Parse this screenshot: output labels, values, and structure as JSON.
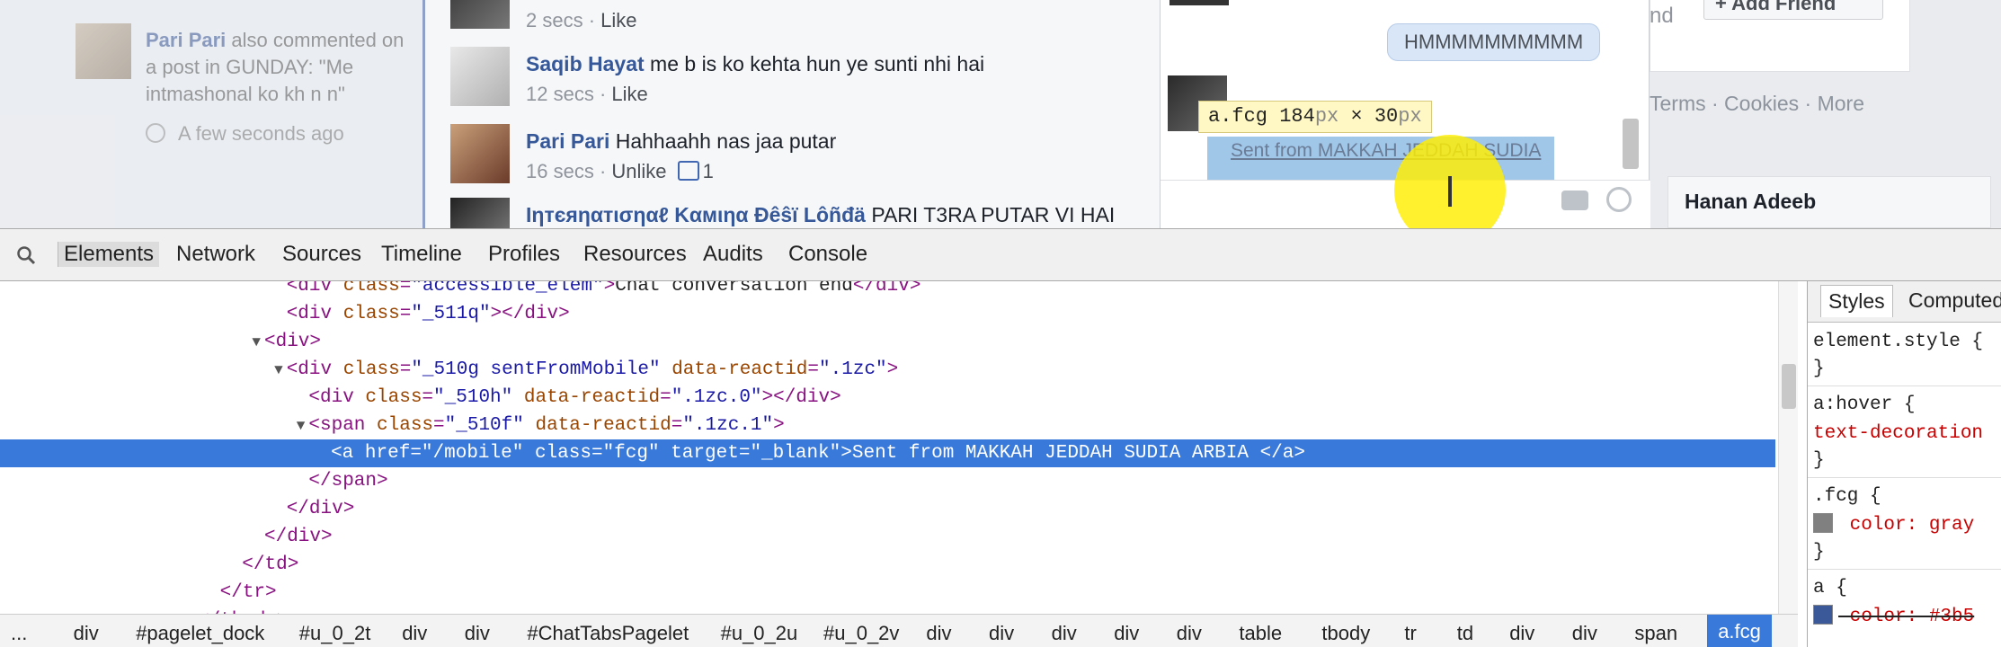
{
  "notification": {
    "author": "Pari Pari",
    "text": "also commented on a post in GUNDAY: \"Me intmashonal ko kh n n\"",
    "time": "A few seconds ago"
  },
  "comments": [
    {
      "author": "",
      "text": "",
      "time": "2 secs",
      "action": "Like",
      "likes": ""
    },
    {
      "author": "Saqib Hayat",
      "text": "me b is ko kehta hun ye sunti nhi hai",
      "time": "12 secs",
      "action": "Like",
      "likes": ""
    },
    {
      "author": "Pari Pari",
      "text": "Hahhaahh nas jaa putar",
      "time": "16 secs",
      "action": "Unlike",
      "likes": "1"
    },
    {
      "author": "Ɩηтєяηαтισηαℓ Kαмιηα Đêŝï Lôñđä",
      "text": "PARI T3RA PUTAR VI HAI",
      "time": "",
      "action": "",
      "likes": ""
    }
  ],
  "chat": {
    "message": "HMMMMMMMMMM",
    "tooltip_tag": "a.fcg",
    "tooltip_w": "184",
    "tooltip_h": "30",
    "tooltip_unit": "px",
    "tooltip_x": "×",
    "sent_from": "Sent from MAKKAH JEDDAH SUDIA"
  },
  "right_column": {
    "add_friend": "Add Friend",
    "partial": "nd",
    "footer": "Terms · Cookies · More",
    "friend_name": "Hanan Adeeb"
  },
  "devtools": {
    "tabs": [
      "Elements",
      "Network",
      "Sources",
      "Timeline",
      "Profiles",
      "Resources",
      "Audits",
      "Console"
    ],
    "active_tab": "Elements",
    "dom_lines": [
      {
        "indent": 25,
        "tri": "",
        "html": "<div class=\"accessible_elem\">Chat conversation end</div>"
      },
      {
        "indent": 25,
        "tri": "",
        "html": "<div class=\"_511q\"></div>"
      },
      {
        "indent": 23,
        "tri": "▼",
        "html": "<div>"
      },
      {
        "indent": 25,
        "tri": "▼",
        "html": "<div class=\"_510g sentFromMobile\" data-reactid=\".1zc\">"
      },
      {
        "indent": 27,
        "tri": "",
        "html": "<div class=\"_510h\" data-reactid=\".1zc.0\"></div>"
      },
      {
        "indent": 27,
        "tri": "▼",
        "html": "<span class=\"_510f\" data-reactid=\".1zc.1\">"
      },
      {
        "indent": 29,
        "tri": "",
        "html": "<a href=\"/mobile\" class=\"fcg\" target=\"_blank\">Sent from MAKKAH JEDDAH SUDIA ARBIA </a>",
        "selected": true
      },
      {
        "indent": 27,
        "tri": "",
        "html": "</span>"
      },
      {
        "indent": 25,
        "tri": "",
        "html": "</div>"
      },
      {
        "indent": 23,
        "tri": "",
        "html": "</div>"
      },
      {
        "indent": 21,
        "tri": "",
        "html": "</td>"
      },
      {
        "indent": 19,
        "tri": "",
        "html": "</tr>"
      },
      {
        "indent": 17,
        "tri": "",
        "html": "</tbody>"
      }
    ],
    "breadcrumbs": [
      "...",
      "div",
      "#pagelet_dock",
      "#u_0_2t",
      "div",
      "div",
      "#ChatTabsPagelet",
      "#u_0_2u",
      "#u_0_2v",
      "div",
      "div",
      "div",
      "div",
      "div",
      "table",
      "tbody",
      "tr",
      "td",
      "div",
      "div",
      "span",
      "a.fcg"
    ],
    "styles_tabs": [
      "Styles",
      "Computed"
    ],
    "styles_lines": [
      "element.style {",
      "}",
      "a:hover {",
      "  text-decoration",
      "}",
      ".fcg {",
      "  color: gray",
      "}",
      "a {",
      "  color: #3b5"
    ],
    "colors": {
      "selection": "#3879d9",
      "gray_swatch": "#808080",
      "link_swatch": "#3b5998"
    }
  }
}
